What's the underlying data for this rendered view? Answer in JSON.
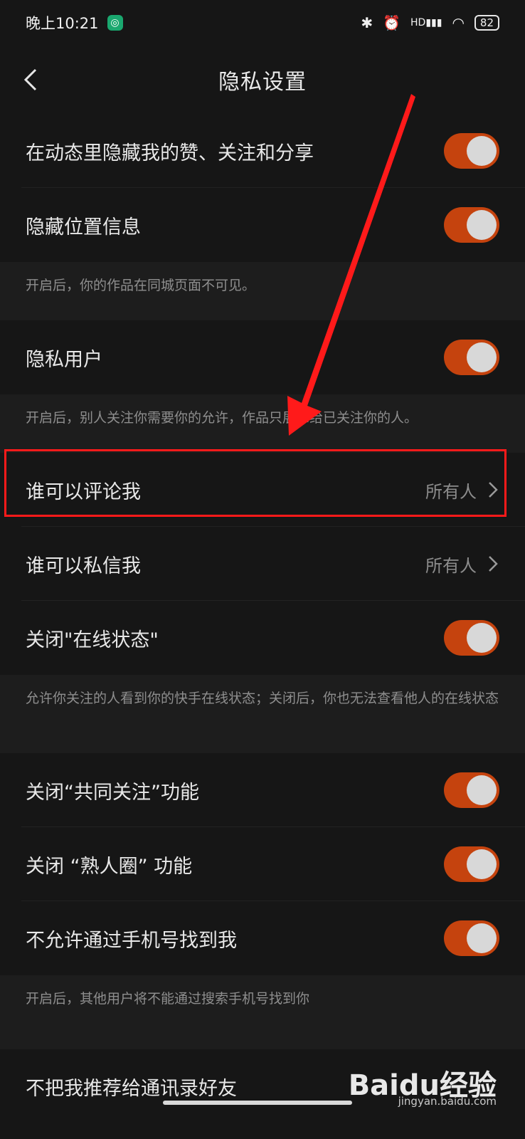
{
  "status_bar": {
    "time": "晚上10:21",
    "battery": "82",
    "signal_label": "HD"
  },
  "header": {
    "title": "隐私设置"
  },
  "rows": [
    {
      "label": "在动态里隐藏我的赞、关注和分享",
      "toggle": true
    },
    {
      "label": "隐藏位置信息",
      "toggle": true
    },
    {
      "note": "开启后，你的作品在同城页面不可见。"
    },
    {
      "label": "隐私用户",
      "toggle": true
    },
    {
      "note": "开启后，别人关注你需要你的允许，作品只展示给已关注你的人。"
    },
    {
      "label": "谁可以评论我",
      "value": "所有人"
    },
    {
      "label": "谁可以私信我",
      "value": "所有人"
    },
    {
      "label": "关闭\"在线状态\"",
      "toggle": true
    },
    {
      "note": "允许你关注的人看到你的快手在线状态；关闭后，你也无法查看他人的在线状态"
    },
    {
      "label": "关闭“共同关注”功能",
      "toggle": true
    },
    {
      "label": "关闭 “熟人圈” 功能",
      "toggle": true
    },
    {
      "label": "不允许通过手机号找到我",
      "toggle": true
    },
    {
      "note": "开启后，其他用户将不能通过搜索手机号找到你"
    },
    {
      "label": "不把我推荐给通讯录好友"
    }
  ],
  "colors": {
    "accent": "#c5430e",
    "annotation": "#ff1a1a"
  },
  "watermark": {
    "logo": "Baidu经验",
    "sub": "jingyan.baidu.com"
  }
}
